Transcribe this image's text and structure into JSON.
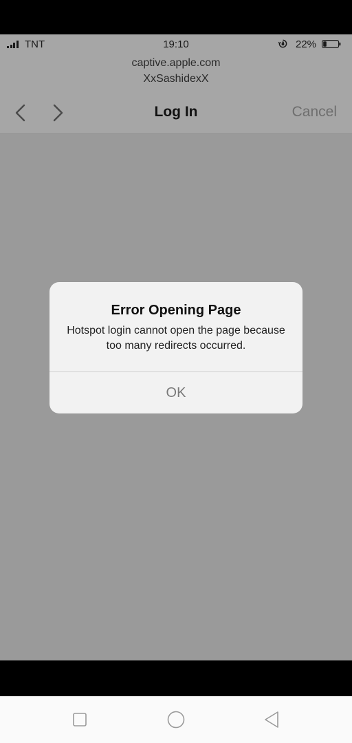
{
  "status_bar": {
    "carrier": "TNT",
    "time": "19:10",
    "battery_percent": "22%",
    "battery_level": 0.22,
    "icons": [
      "signal-icon",
      "orientation-lock-icon",
      "battery-icon"
    ]
  },
  "browser": {
    "host": "captive.apple.com",
    "network_name": "XxSashidexX",
    "title": "Log In",
    "cancel_label": "Cancel",
    "icons": [
      "back-arrow-icon",
      "forward-arrow-icon"
    ]
  },
  "alert": {
    "title": "Error Opening Page",
    "message": "Hotspot login cannot open the page because too many redirects occurred.",
    "ok_label": "OK"
  },
  "system_nav": {
    "icons": [
      "recents-square-icon",
      "home-circle-icon",
      "back-triangle-icon"
    ]
  }
}
